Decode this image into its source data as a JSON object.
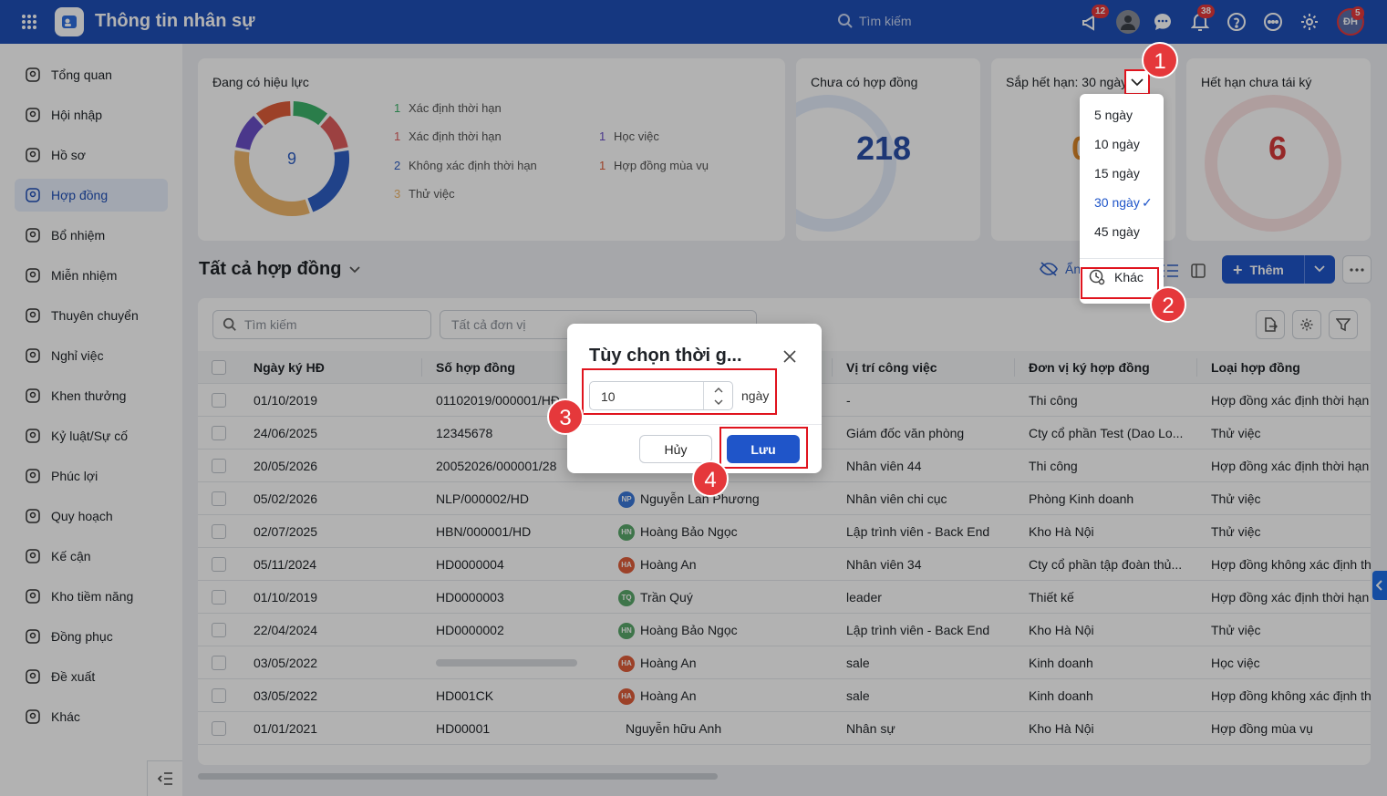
{
  "app": {
    "title": "Thông tin nhân sự",
    "search_placeholder": "Tìm kiếm"
  },
  "topbar": {
    "badges": {
      "announce": "12",
      "notifications": "38",
      "avatar": "5"
    },
    "avatar_initials": "ĐH"
  },
  "sidebar": {
    "items": [
      {
        "label": "Tổng quan",
        "icon": "home-icon"
      },
      {
        "label": "Hội nhập",
        "icon": "users-join-icon"
      },
      {
        "label": "Hồ sơ",
        "icon": "profile-icon"
      },
      {
        "label": "Hợp đồng",
        "icon": "contract-icon"
      },
      {
        "label": "Bổ nhiệm",
        "icon": "appoint-icon"
      },
      {
        "label": "Miễn nhiệm",
        "icon": "dismiss-icon"
      },
      {
        "label": "Thuyên chuyển",
        "icon": "transfer-icon"
      },
      {
        "label": "Nghỉ việc",
        "icon": "resign-icon"
      },
      {
        "label": "Khen thưởng",
        "icon": "reward-icon"
      },
      {
        "label": "Kỷ luật/Sự cố",
        "icon": "discipline-icon"
      },
      {
        "label": "Phúc lợi",
        "icon": "welfare-icon"
      },
      {
        "label": "Quy hoạch",
        "icon": "planning-icon"
      },
      {
        "label": "Kế cận",
        "icon": "successor-icon"
      },
      {
        "label": "Kho tiềm năng",
        "icon": "talent-pool-icon"
      },
      {
        "label": "Đồng phục",
        "icon": "uniform-icon"
      },
      {
        "label": "Đề xuất",
        "icon": "proposal-icon"
      },
      {
        "label": "Khác",
        "icon": "more-icon"
      }
    ]
  },
  "summary": {
    "active": {
      "title": "Đang có hiệu lực",
      "total": "9",
      "legend": [
        {
          "count": "1",
          "label": "Xác định thời hạn",
          "color": "#3db36b"
        },
        {
          "count": "1",
          "label": "Xác định thời hạn",
          "color": "#e05d5d"
        },
        {
          "count": "2",
          "label": "Không xác định thời hạn",
          "color": "#2f5fc4"
        },
        {
          "count": "3",
          "label": "Thử việc",
          "color": "#f0b66a"
        },
        {
          "count": "1",
          "label": "Học việc",
          "color": "#6a4fc8"
        },
        {
          "count": "1",
          "label": "Hợp đồng mùa vụ",
          "color": "#e05d3a"
        }
      ]
    },
    "no_contract": {
      "title": "Chưa có hợp đồng",
      "value": "218"
    },
    "expiring": {
      "title": "Sắp hết hạn: 30 ngày",
      "value": "0"
    },
    "expired": {
      "title": "Hết hạn chưa tái ký",
      "value": "6"
    }
  },
  "dropdown": {
    "options": [
      "5 ngày",
      "10 ngày",
      "15 ngày",
      "30 ngày",
      "45 ngày"
    ],
    "selected": "30 ngày",
    "other": "Khác"
  },
  "list": {
    "title": "Tất cả hợp đồng",
    "hide_label": "Ẩn",
    "add_label": "Thêm",
    "search_placeholder": "Tìm kiếm",
    "unit_placeholder": "Tất cả đơn vị"
  },
  "table": {
    "headers": [
      "Ngày ký HĐ",
      "Số hợp đồng",
      "",
      "Vị trí công việc",
      "Đơn vị ký hợp đồng",
      "Loại hợp đồng"
    ],
    "rows": [
      {
        "date": "01/10/2019",
        "no": "01102019/000001/HĐ",
        "emp": "",
        "initials": "",
        "pos": "-",
        "unit": "Thi công",
        "type": "Hợp đồng xác định thời hạn"
      },
      {
        "date": "24/06/2025",
        "no": "12345678",
        "emp": "",
        "initials": "",
        "pos": "Giám đốc văn phòng",
        "unit": "Cty cổ phần Test (Dao Lo...",
        "type": "Thử việc"
      },
      {
        "date": "20/05/2026",
        "no": "20052026/000001/28",
        "emp": "",
        "initials": "",
        "pos": "Nhân viên 44",
        "unit": "Thi công",
        "type": "Hợp đồng xác định thời hạn"
      },
      {
        "date": "05/02/2026",
        "no": "NLP/000002/HD",
        "emp": "Nguyễn Lan Phương",
        "initials": "NP",
        "pos": "Nhân viên chi cục",
        "unit": "Phòng Kinh doanh",
        "type": "Thử việc"
      },
      {
        "date": "02/07/2025",
        "no": "HBN/000001/HD",
        "emp": "Hoàng Bảo Ngọc",
        "initials": "HN",
        "pos": "Lập trình viên - Back End",
        "unit": "Kho Hà Nội",
        "type": "Thử việc"
      },
      {
        "date": "05/11/2024",
        "no": "HD0000004",
        "emp": "Hoàng An",
        "initials": "HA",
        "pos": "Nhân viên 34",
        "unit": "Cty cổ phần tập đoàn thủ...",
        "type": "Hợp đồng không xác định th"
      },
      {
        "date": "01/10/2019",
        "no": "HD0000003",
        "emp": "Trần Quý",
        "initials": "TQ",
        "pos": "leader",
        "unit": "Thiết kế",
        "type": "Hợp đồng xác định thời hạn"
      },
      {
        "date": "22/04/2024",
        "no": "HD0000002",
        "emp": "Hoàng Bảo Ngọc",
        "initials": "HN",
        "pos": "Lập trình viên - Back End",
        "unit": "Kho Hà Nội",
        "type": "Thử việc"
      },
      {
        "date": "03/05/2022",
        "no": "",
        "emp": "Hoàng An",
        "initials": "HA",
        "pos": "sale",
        "unit": "Kinh doanh",
        "type": "Học việc"
      },
      {
        "date": "03/05/2022",
        "no": "HD001CK",
        "emp": "Hoàng An",
        "initials": "HA",
        "pos": "sale",
        "unit": "Kinh doanh",
        "type": "Hợp đồng không xác định th"
      },
      {
        "date": "01/01/2021",
        "no": "HD00001",
        "emp": "Nguyễn hữu Anh",
        "initials": "",
        "pos": "Nhân sự",
        "unit": "Kho Hà Nội",
        "type": "Hợp đồng mùa vụ"
      }
    ]
  },
  "modal": {
    "title": "Tùy chọn thời g...",
    "value": "10",
    "unit": "ngày",
    "cancel": "Hủy",
    "save": "Lưu"
  },
  "annotations": [
    "1",
    "2",
    "3",
    "4"
  ],
  "colors": {
    "primary": "#1f4fb8",
    "annotation": "#e5383b"
  }
}
